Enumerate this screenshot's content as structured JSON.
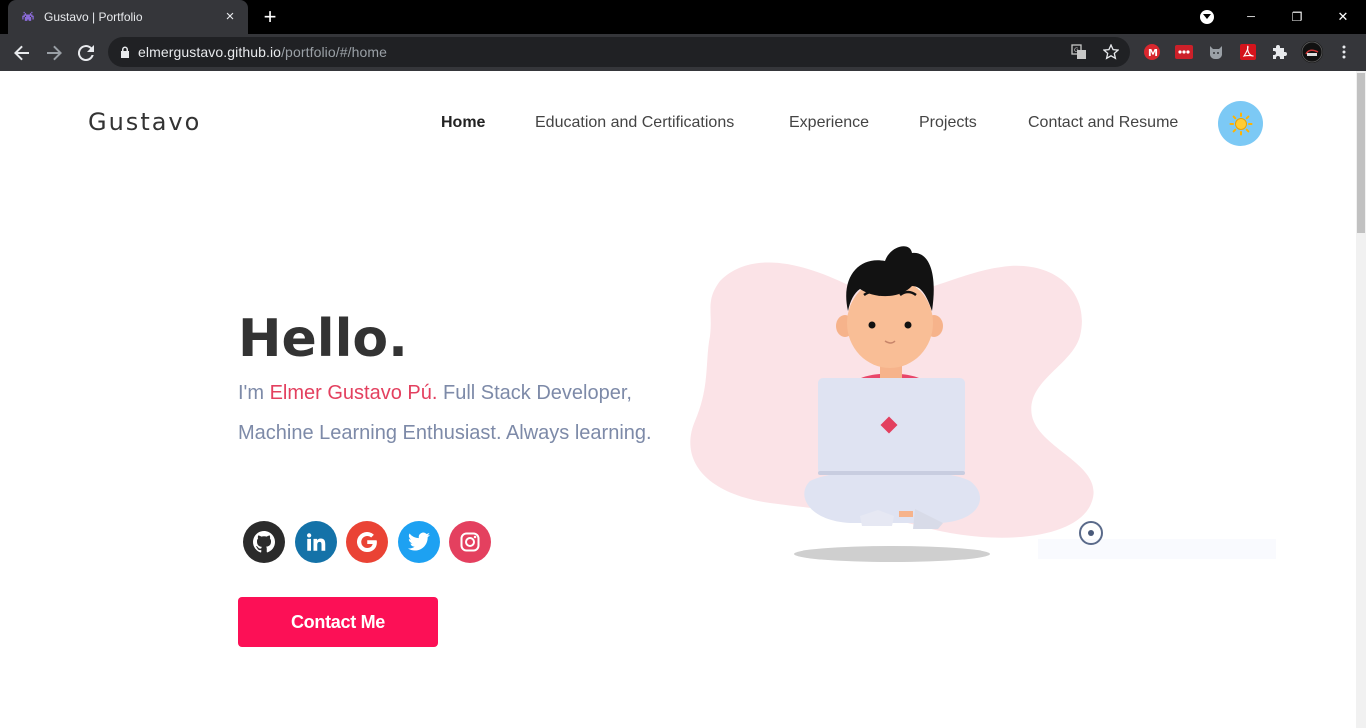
{
  "browser": {
    "tab_title": "Gustavo | Portfolio",
    "tab_close": "×",
    "new_tab": "+",
    "url_host": "elmergustavo.github.io",
    "url_path": "/portfolio/#/home",
    "controls": {
      "minimize": "─",
      "restore": "❐",
      "close": "✕"
    }
  },
  "header": {
    "logo": "Gustavo",
    "nav": [
      {
        "label": "Home",
        "active": true
      },
      {
        "label": "Education and Certifications",
        "active": false
      },
      {
        "label": "Experience",
        "active": false
      },
      {
        "label": "Projects",
        "active": false
      },
      {
        "label": "Contact and Resume",
        "active": false
      }
    ],
    "theme_icon": "sun-icon"
  },
  "hero": {
    "greeting": "Hello.",
    "intro_prefix": "I'm ",
    "name": "Elmer Gustavo Pú.",
    "intro_rest": " Full Stack Developer, Machine Learning Enthusiast. Always learning.",
    "social": [
      {
        "name": "github-icon",
        "color": "#2b2b2b"
      },
      {
        "name": "linkedin-icon",
        "color": "#1472a8"
      },
      {
        "name": "google-icon",
        "color": "#ea4335"
      },
      {
        "name": "twitter-icon",
        "color": "#1da1f2"
      },
      {
        "name": "instagram-icon",
        "color": "#e4405f"
      }
    ],
    "cta": "Contact Me"
  },
  "colors": {
    "accent": "#fc1056",
    "name_highlight": "#e3405f",
    "intro_text": "#7d8aa8",
    "blob": "#fbe3e7",
    "theme_toggle": "#7cc9f5"
  }
}
